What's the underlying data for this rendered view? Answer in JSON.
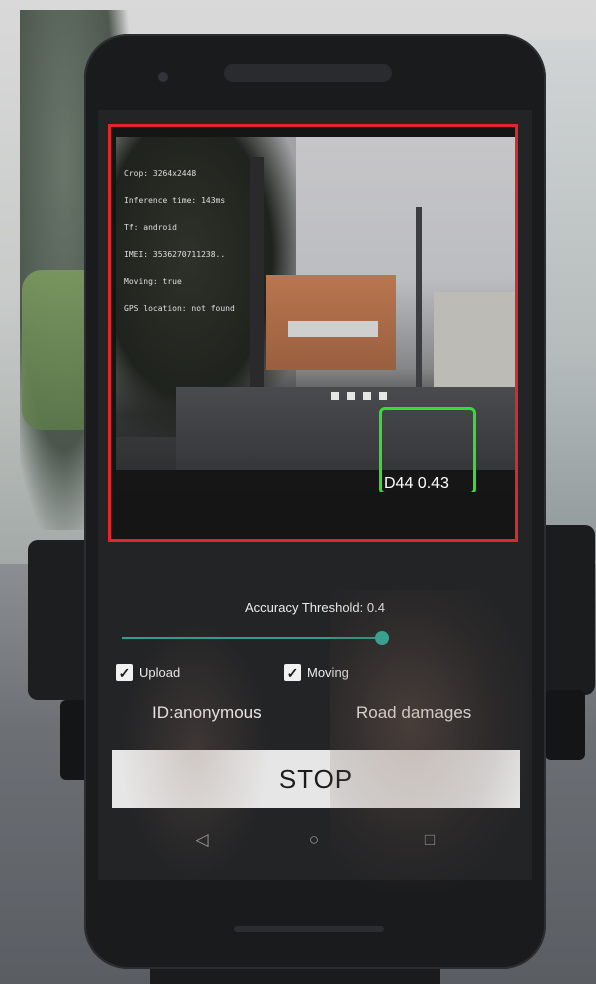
{
  "overlay": {
    "lines": [
      "Crop: 3264x2448",
      "Inference time: 143ms",
      "Tf: android",
      "IMEI: 3536270711238..",
      "Moving: true",
      "GPS location: not found"
    ]
  },
  "detection": {
    "label": "D44 0.43",
    "box_color": "#2fe02f"
  },
  "preview_border_color": "#e0262a",
  "controls": {
    "threshold_label": "Accuracy Threshold: 0.4",
    "threshold_value": 0.4,
    "upload": {
      "label": "Upload",
      "checked": true
    },
    "moving": {
      "label": "Moving",
      "checked": true
    },
    "id_label": "ID:anonymous",
    "mode_label": "Road damages",
    "stop_label": "STOP"
  },
  "navbar": {
    "back_icon": "◁",
    "home_icon": "○",
    "recents_icon": "□"
  },
  "colors": {
    "accent": "#2fb2a0",
    "stop_button_bg": "#e6e6e6"
  }
}
